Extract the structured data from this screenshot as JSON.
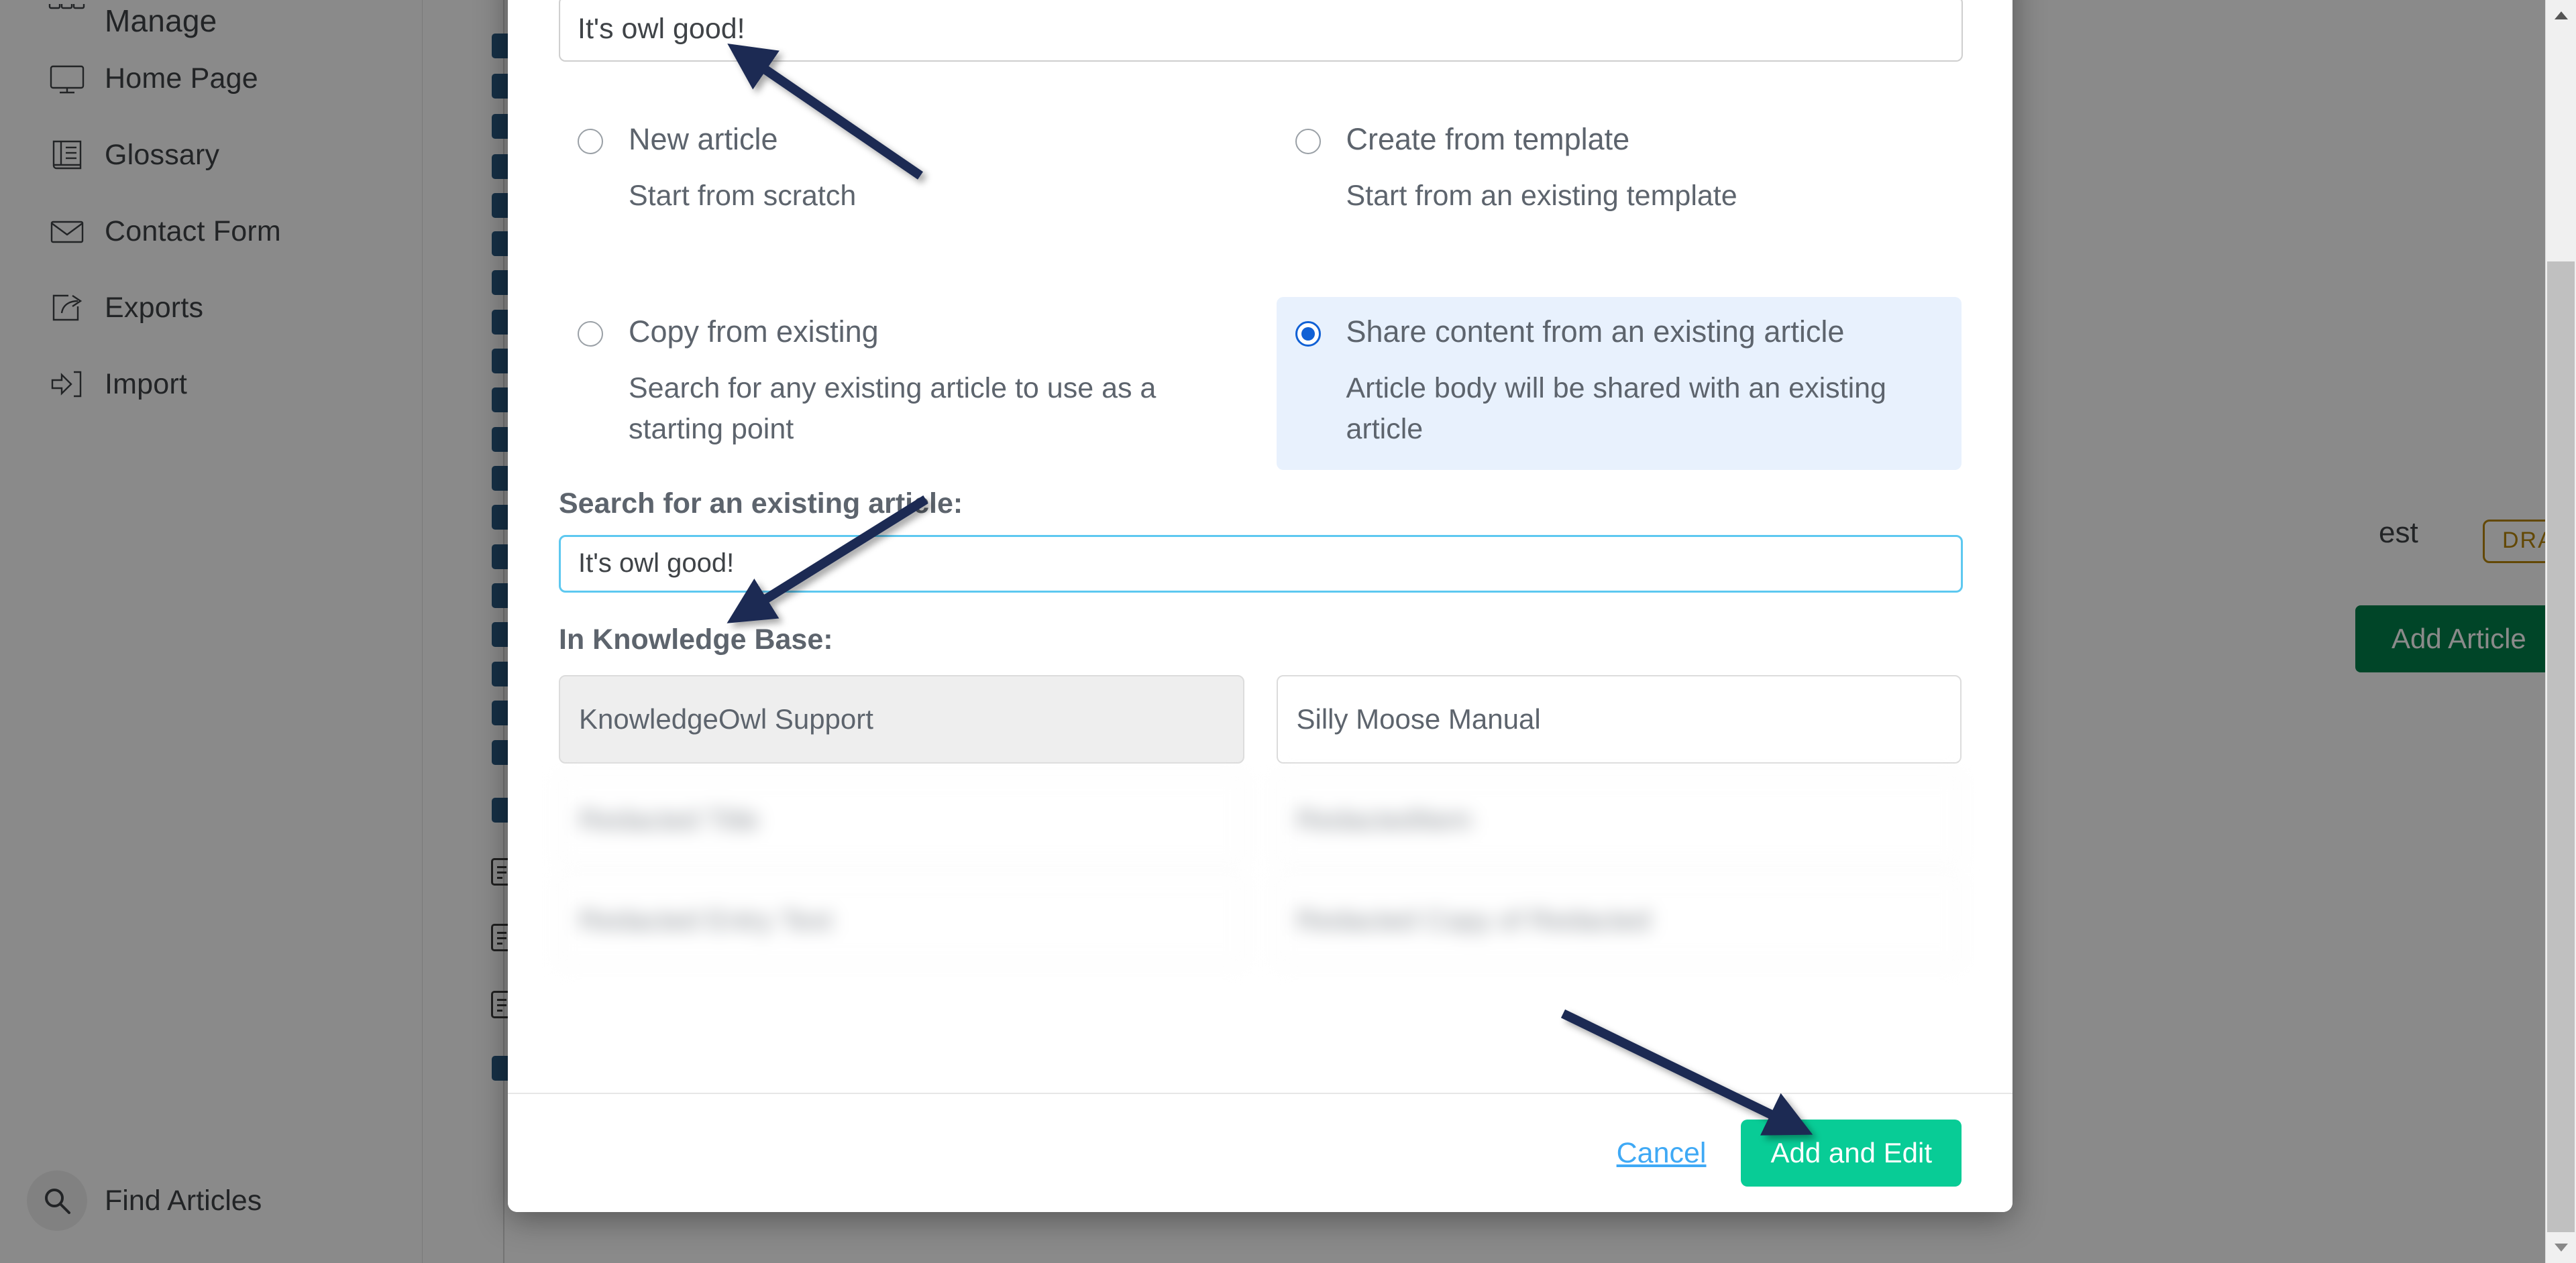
{
  "sidebar": {
    "items": [
      {
        "label": "Manage",
        "icon": "grid-manage-icon"
      },
      {
        "label": "Home Page",
        "icon": "monitor-icon"
      },
      {
        "label": "Glossary",
        "icon": "book-icon"
      },
      {
        "label": "Contact Form",
        "icon": "envelope-icon"
      },
      {
        "label": "Exports",
        "icon": "share-export-icon"
      },
      {
        "label": "Import",
        "icon": "import-arrow-icon"
      }
    ],
    "find_articles": {
      "label": "Find Articles",
      "icon": "search-icon"
    }
  },
  "background": {
    "article_title": "est",
    "draft_badge": "DRAFT",
    "add_article_button": "Add Article"
  },
  "modal": {
    "title_input": {
      "value": "It's owl good!",
      "placeholder": "Article title"
    },
    "options": [
      {
        "title": "New article",
        "description": "Start from scratch",
        "selected": false
      },
      {
        "title": "Create from template",
        "description": "Start from an existing template",
        "selected": false
      },
      {
        "title": "Copy from existing",
        "description": "Search for any existing article to use as a starting point",
        "selected": false
      },
      {
        "title": "Share content from an existing article",
        "description": "Article body will be shared with an existing article",
        "selected": true
      }
    ],
    "search": {
      "label": "Search for an existing article:",
      "value": "It's owl good!",
      "placeholder": "Search for an existing article"
    },
    "knowledge_base": {
      "label": "In Knowledge Base:",
      "columns": [
        {
          "items": [
            {
              "label": "KnowledgeOwl Support",
              "state": "active",
              "blurred": false
            },
            {
              "label": "",
              "state": "default",
              "blurred": true
            },
            {
              "label": "",
              "state": "default",
              "blurred": true
            }
          ]
        },
        {
          "items": [
            {
              "label": "Silly Moose Manual",
              "state": "default",
              "blurred": false
            },
            {
              "label": "",
              "state": "default",
              "blurred": true
            },
            {
              "label": "",
              "state": "default",
              "blurred": true
            }
          ]
        }
      ]
    },
    "footer": {
      "cancel_label": "Cancel",
      "submit_label": "Add and Edit"
    }
  },
  "colors": {
    "accent_green": "#08cc96",
    "selected_blue": "#1161d5",
    "selected_bg": "#e8f1fd",
    "focus_border": "#5dc8f0",
    "draft_amber": "#b8860b",
    "annotation_navy": "#1b2a52",
    "link_blue": "#3fa9f5"
  }
}
